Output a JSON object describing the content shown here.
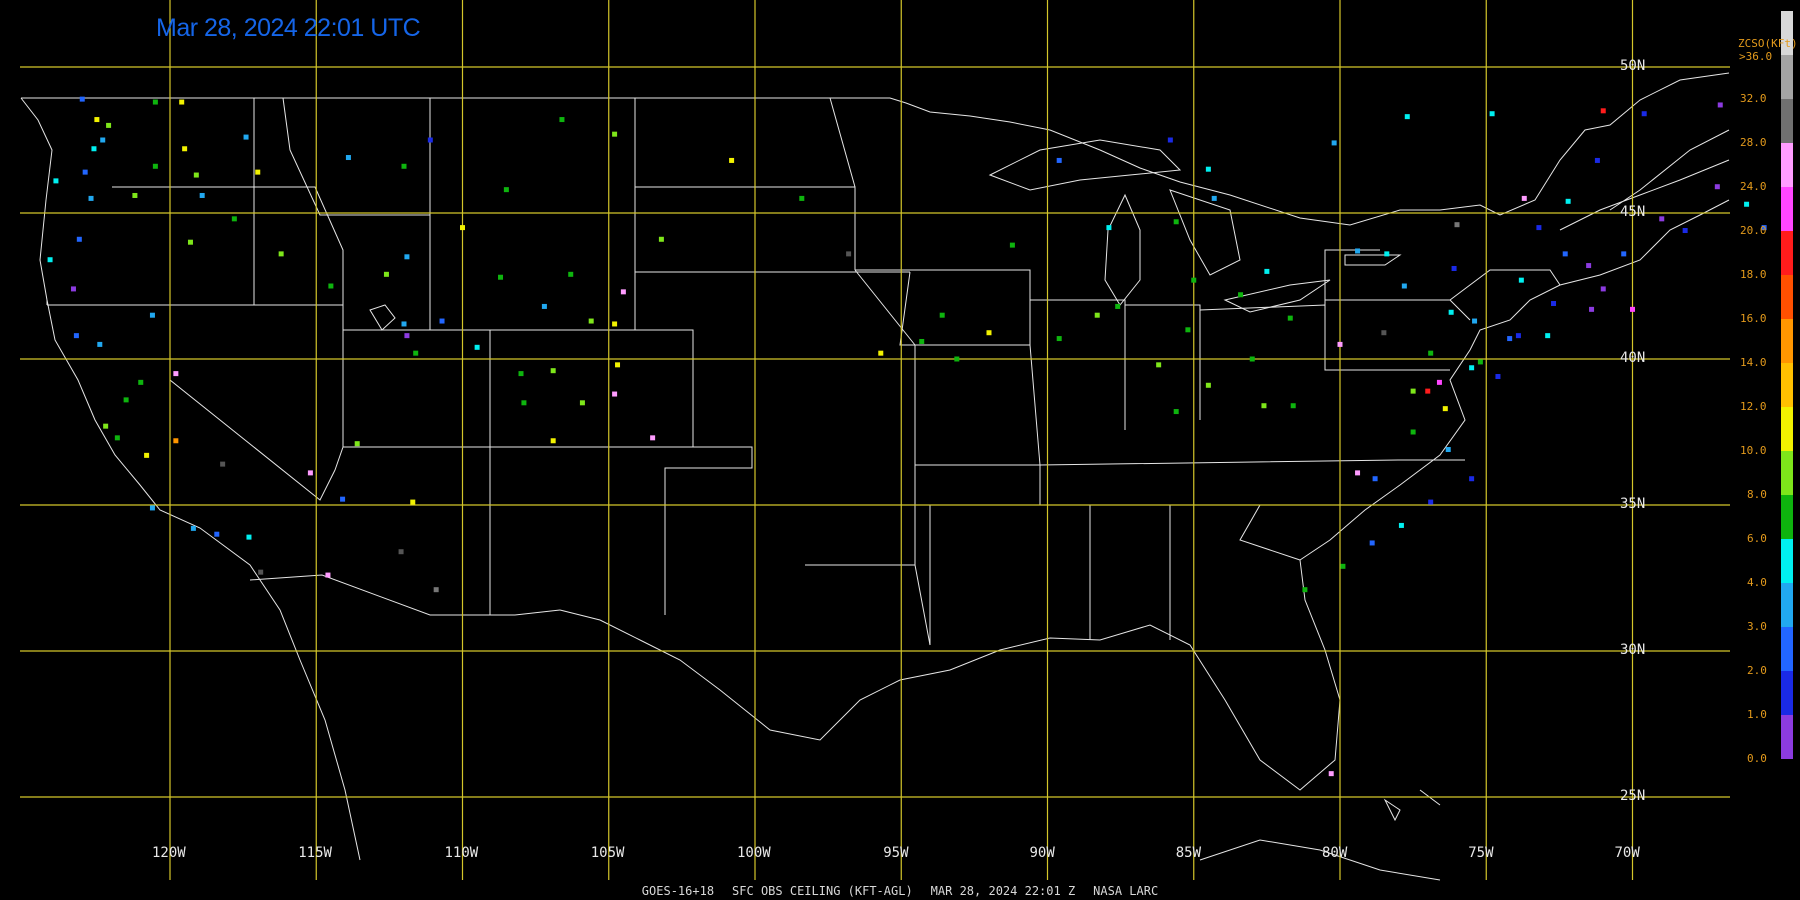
{
  "timestamp": "Mar 28, 2024 22:01 UTC",
  "footer": {
    "satellite": "GOES-16+18",
    "product": "SFC OBS CEILING (KFT-AGL)",
    "datetime": "MAR 28, 2024 22:01 Z",
    "source": "NASA LARC"
  },
  "graticule": {
    "longitudes": [
      {
        "value": -120,
        "label": "120W"
      },
      {
        "value": -115,
        "label": "115W"
      },
      {
        "value": -110,
        "label": "110W"
      },
      {
        "value": -105,
        "label": "105W"
      },
      {
        "value": -100,
        "label": "100W"
      },
      {
        "value": -95,
        "label": "95W"
      },
      {
        "value": -90,
        "label": "90W"
      },
      {
        "value": -85,
        "label": "85W"
      },
      {
        "value": -80,
        "label": "80W"
      },
      {
        "value": -75,
        "label": "75W"
      },
      {
        "value": -70,
        "label": "70W"
      }
    ],
    "latitudes": [
      {
        "value": 50,
        "label": "50N"
      },
      {
        "value": 45,
        "label": "45N"
      },
      {
        "value": 40,
        "label": "40N"
      },
      {
        "value": 35,
        "label": "35N"
      },
      {
        "value": 30,
        "label": "30N"
      },
      {
        "value": 25,
        "label": "25N"
      }
    ],
    "grid_color": "#d4c62a",
    "boundary_color": "#e6e6e6"
  },
  "legend": {
    "title": "ZCSO(KFt)",
    "top_label": ">36.0",
    "bins": [
      {
        "label": "0.0",
        "color": "#8c3be0"
      },
      {
        "label": "1.0",
        "color": "#1a2ae6"
      },
      {
        "label": "2.0",
        "color": "#2266ff"
      },
      {
        "label": "3.0",
        "color": "#21a8f0"
      },
      {
        "label": "4.0",
        "color": "#00f0f0"
      },
      {
        "label": "6.0",
        "color": "#0eb40e"
      },
      {
        "label": "8.0",
        "color": "#7ee61a"
      },
      {
        "label": "10.0",
        "color": "#f2f200"
      },
      {
        "label": "12.0",
        "color": "#ffc000"
      },
      {
        "label": "14.0",
        "color": "#ff9600"
      },
      {
        "label": "16.0",
        "color": "#ff5000"
      },
      {
        "label": "18.0",
        "color": "#ff1c1c"
      },
      {
        "label": "20.0",
        "color": "#ff46ff"
      },
      {
        "label": "24.0",
        "color": "#ff9cff"
      },
      {
        "label": "28.0",
        "color": "#707070"
      },
      {
        "label": "32.0",
        "color": "#a4a4a4"
      },
      {
        "label": "",
        "color": "#d8d8d8"
      }
    ]
  },
  "observations": [
    {
      "lon": -123.0,
      "lat": 48.9,
      "color": "#2266ff"
    },
    {
      "lon": -122.3,
      "lat": 47.5,
      "color": "#21a8f0"
    },
    {
      "lon": -122.6,
      "lat": 47.2,
      "color": "#00f0f0"
    },
    {
      "lon": -122.9,
      "lat": 46.4,
      "color": "#2266ff"
    },
    {
      "lon": -123.9,
      "lat": 46.1,
      "color": "#00f0f0"
    },
    {
      "lon": -122.7,
      "lat": 45.5,
      "color": "#21a8f0"
    },
    {
      "lon": -123.1,
      "lat": 44.1,
      "color": "#2266ff"
    },
    {
      "lon": -124.1,
      "lat": 43.4,
      "color": "#00f0f0"
    },
    {
      "lon": -123.3,
      "lat": 42.4,
      "color": "#8c3be0"
    },
    {
      "lon": -122.5,
      "lat": 48.2,
      "color": "#f2f200"
    },
    {
      "lon": -122.1,
      "lat": 48.0,
      "color": "#7ee61a"
    },
    {
      "lon": -120.5,
      "lat": 48.8,
      "color": "#0eb40e"
    },
    {
      "lon": -119.6,
      "lat": 48.8,
      "color": "#f2f200"
    },
    {
      "lon": -117.4,
      "lat": 47.6,
      "color": "#21a8f0"
    },
    {
      "lon": -119.5,
      "lat": 47.2,
      "color": "#f2f200"
    },
    {
      "lon": -119.1,
      "lat": 46.3,
      "color": "#7ee61a"
    },
    {
      "lon": -120.5,
      "lat": 46.6,
      "color": "#0eb40e"
    },
    {
      "lon": -121.2,
      "lat": 45.6,
      "color": "#7ee61a"
    },
    {
      "lon": -118.9,
      "lat": 45.6,
      "color": "#21a8f0"
    },
    {
      "lon": -117.8,
      "lat": 44.8,
      "color": "#0eb40e"
    },
    {
      "lon": -119.3,
      "lat": 44.0,
      "color": "#7ee61a"
    },
    {
      "lon": -117.0,
      "lat": 46.4,
      "color": "#f2f200"
    },
    {
      "lon": -116.2,
      "lat": 43.6,
      "color": "#7ee61a"
    },
    {
      "lon": -114.5,
      "lat": 42.5,
      "color": "#0eb40e"
    },
    {
      "lon": -112.6,
      "lat": 42.9,
      "color": "#7ee61a"
    },
    {
      "lon": -111.9,
      "lat": 43.5,
      "color": "#21a8f0"
    },
    {
      "lon": -112.0,
      "lat": 46.6,
      "color": "#0eb40e"
    },
    {
      "lon": -111.1,
      "lat": 47.5,
      "color": "#1a2ae6"
    },
    {
      "lon": -108.5,
      "lat": 45.8,
      "color": "#0eb40e"
    },
    {
      "lon": -106.6,
      "lat": 48.2,
      "color": "#0eb40e"
    },
    {
      "lon": -104.8,
      "lat": 47.7,
      "color": "#7ee61a"
    },
    {
      "lon": -113.9,
      "lat": 46.9,
      "color": "#21a8f0"
    },
    {
      "lon": -110.0,
      "lat": 44.5,
      "color": "#f2f200"
    },
    {
      "lon": -108.7,
      "lat": 42.8,
      "color": "#0eb40e"
    },
    {
      "lon": -106.3,
      "lat": 42.9,
      "color": "#0eb40e"
    },
    {
      "lon": -104.8,
      "lat": 41.2,
      "color": "#f2f200"
    },
    {
      "lon": -105.6,
      "lat": 41.3,
      "color": "#7ee61a"
    },
    {
      "lon": -107.2,
      "lat": 41.8,
      "color": "#21a8f0"
    },
    {
      "lon": -110.7,
      "lat": 41.3,
      "color": "#2266ff"
    },
    {
      "lon": -111.9,
      "lat": 40.8,
      "color": "#8c3be0"
    },
    {
      "lon": -112.0,
      "lat": 41.2,
      "color": "#21a8f0"
    },
    {
      "lon": -111.6,
      "lat": 40.2,
      "color": "#0eb40e"
    },
    {
      "lon": -109.5,
      "lat": 40.4,
      "color": "#00f0f0"
    },
    {
      "lon": -108.0,
      "lat": 39.5,
      "color": "#0eb40e"
    },
    {
      "lon": -106.9,
      "lat": 39.6,
      "color": "#7ee61a"
    },
    {
      "lon": -104.7,
      "lat": 39.8,
      "color": "#f2f200"
    },
    {
      "lon": -104.8,
      "lat": 38.8,
      "color": "#ff9cff"
    },
    {
      "lon": -105.9,
      "lat": 38.5,
      "color": "#7ee61a"
    },
    {
      "lon": -107.9,
      "lat": 38.5,
      "color": "#0eb40e"
    },
    {
      "lon": -106.9,
      "lat": 37.2,
      "color": "#f2f200"
    },
    {
      "lon": -103.5,
      "lat": 37.3,
      "color": "#ff9cff"
    },
    {
      "lon": -104.5,
      "lat": 42.3,
      "color": "#ff9cff"
    },
    {
      "lon": -103.2,
      "lat": 44.1,
      "color": "#7ee61a"
    },
    {
      "lon": -100.8,
      "lat": 46.8,
      "color": "#f2f200"
    },
    {
      "lon": -98.4,
      "lat": 45.5,
      "color": "#0eb40e"
    },
    {
      "lon": -96.8,
      "lat": 43.6,
      "color": "#555555"
    },
    {
      "lon": -113.6,
      "lat": 37.1,
      "color": "#7ee61a"
    },
    {
      "lon": -115.2,
      "lat": 36.1,
      "color": "#ff9cff"
    },
    {
      "lon": -114.1,
      "lat": 35.2,
      "color": "#2266ff"
    },
    {
      "lon": -111.7,
      "lat": 35.1,
      "color": "#f2f200"
    },
    {
      "lon": -112.1,
      "lat": 33.4,
      "color": "#555555"
    },
    {
      "lon": -110.9,
      "lat": 32.1,
      "color": "#777777"
    },
    {
      "lon": -114.6,
      "lat": 32.6,
      "color": "#ff9cff"
    },
    {
      "lon": -116.9,
      "lat": 32.7,
      "color": "#555555"
    },
    {
      "lon": -117.3,
      "lat": 33.9,
      "color": "#00f0f0"
    },
    {
      "lon": -118.4,
      "lat": 34.0,
      "color": "#2266ff"
    },
    {
      "lon": -119.2,
      "lat": 34.2,
      "color": "#21a8f0"
    },
    {
      "lon": -120.6,
      "lat": 34.9,
      "color": "#21a8f0"
    },
    {
      "lon": -120.8,
      "lat": 36.7,
      "color": "#f2f200"
    },
    {
      "lon": -121.8,
      "lat": 37.3,
      "color": "#0eb40e"
    },
    {
      "lon": -122.2,
      "lat": 37.7,
      "color": "#7ee61a"
    },
    {
      "lon": -121.5,
      "lat": 38.6,
      "color": "#0eb40e"
    },
    {
      "lon": -121.0,
      "lat": 39.2,
      "color": "#0eb40e"
    },
    {
      "lon": -119.8,
      "lat": 39.5,
      "color": "#ff9cff"
    },
    {
      "lon": -119.8,
      "lat": 37.2,
      "color": "#ff9600"
    },
    {
      "lon": -122.4,
      "lat": 40.5,
      "color": "#21a8f0"
    },
    {
      "lon": -123.2,
      "lat": 40.8,
      "color": "#2266ff"
    },
    {
      "lon": -120.6,
      "lat": 41.5,
      "color": "#21a8f0"
    },
    {
      "lon": -118.2,
      "lat": 36.4,
      "color": "#555555"
    },
    {
      "lon": -93.1,
      "lat": 40.0,
      "color": "#0eb40e"
    },
    {
      "lon": -93.6,
      "lat": 41.5,
      "color": "#0eb40e"
    },
    {
      "lon": -89.6,
      "lat": 40.7,
      "color": "#0eb40e"
    },
    {
      "lon": -88.3,
      "lat": 41.5,
      "color": "#7ee61a"
    },
    {
      "lon": -87.6,
      "lat": 41.8,
      "color": "#0eb40e"
    },
    {
      "lon": -86.2,
      "lat": 39.8,
      "color": "#7ee61a"
    },
    {
      "lon": -85.2,
      "lat": 41.0,
      "color": "#0eb40e"
    },
    {
      "lon": -84.5,
      "lat": 39.1,
      "color": "#7ee61a"
    },
    {
      "lon": -83.0,
      "lat": 40.0,
      "color": "#0eb40e"
    },
    {
      "lon": -81.7,
      "lat": 41.4,
      "color": "#0eb40e"
    },
    {
      "lon": -82.6,
      "lat": 38.4,
      "color": "#7ee61a"
    },
    {
      "lon": -81.6,
      "lat": 38.4,
      "color": "#0eb40e"
    },
    {
      "lon": -85.6,
      "lat": 38.2,
      "color": "#0eb40e"
    },
    {
      "lon": -84.3,
      "lat": 45.5,
      "color": "#21a8f0"
    },
    {
      "lon": -85.6,
      "lat": 44.7,
      "color": "#0eb40e"
    },
    {
      "lon": -87.9,
      "lat": 44.5,
      "color": "#00f0f0"
    },
    {
      "lon": -84.5,
      "lat": 46.5,
      "color": "#00f0f0"
    },
    {
      "lon": -85.0,
      "lat": 42.7,
      "color": "#0eb40e"
    },
    {
      "lon": -83.4,
      "lat": 42.2,
      "color": "#0eb40e"
    },
    {
      "lon": -82.5,
      "lat": 43.0,
      "color": "#00f0f0"
    },
    {
      "lon": -89.6,
      "lat": 46.8,
      "color": "#2266ff"
    },
    {
      "lon": -85.8,
      "lat": 47.5,
      "color": "#1a2ae6"
    },
    {
      "lon": -80.2,
      "lat": 47.4,
      "color": "#21a8f0"
    },
    {
      "lon": -77.7,
      "lat": 48.3,
      "color": "#00f0f0"
    },
    {
      "lon": -74.8,
      "lat": 48.4,
      "color": "#00f0f0"
    },
    {
      "lon": -71.0,
      "lat": 48.5,
      "color": "#ff1c1c"
    },
    {
      "lon": -69.6,
      "lat": 48.4,
      "color": "#1a2ae6"
    },
    {
      "lon": -67.0,
      "lat": 48.7,
      "color": "#8c3be0"
    },
    {
      "lon": -79.4,
      "lat": 43.7,
      "color": "#21a8f0"
    },
    {
      "lon": -76.0,
      "lat": 44.6,
      "color": "#777777"
    },
    {
      "lon": -73.7,
      "lat": 45.5,
      "color": "#ff9cff"
    },
    {
      "lon": -71.2,
      "lat": 46.8,
      "color": "#1a2ae6"
    },
    {
      "lon": -72.2,
      "lat": 45.4,
      "color": "#00f0f0"
    },
    {
      "lon": -73.2,
      "lat": 44.5,
      "color": "#1a2ae6"
    },
    {
      "lon": -72.3,
      "lat": 43.6,
      "color": "#2266ff"
    },
    {
      "lon": -71.5,
      "lat": 43.2,
      "color": "#8c3be0"
    },
    {
      "lon": -70.3,
      "lat": 43.6,
      "color": "#2266ff"
    },
    {
      "lon": -69.0,
      "lat": 44.8,
      "color": "#8c3be0"
    },
    {
      "lon": -68.2,
      "lat": 44.4,
      "color": "#1a2ae6"
    },
    {
      "lon": -67.1,
      "lat": 45.9,
      "color": "#8c3be0"
    },
    {
      "lon": -65.5,
      "lat": 44.5,
      "color": "#2266ff"
    },
    {
      "lon": -66.1,
      "lat": 45.3,
      "color": "#00f0f0"
    },
    {
      "lon": -73.8,
      "lat": 42.7,
      "color": "#00f0f0"
    },
    {
      "lon": -72.7,
      "lat": 41.9,
      "color": "#1a2ae6"
    },
    {
      "lon": -71.4,
      "lat": 41.7,
      "color": "#8c3be0"
    },
    {
      "lon": -71.0,
      "lat": 42.4,
      "color": "#8c3be0"
    },
    {
      "lon": -70.0,
      "lat": 41.7,
      "color": "#ff46ff"
    },
    {
      "lon": -73.9,
      "lat": 40.8,
      "color": "#1a2ae6"
    },
    {
      "lon": -74.2,
      "lat": 40.7,
      "color": "#2266ff"
    },
    {
      "lon": -72.9,
      "lat": 40.8,
      "color": "#00f0f0"
    },
    {
      "lon": -75.2,
      "lat": 39.9,
      "color": "#0eb40e"
    },
    {
      "lon": -74.6,
      "lat": 39.4,
      "color": "#1a2ae6"
    },
    {
      "lon": -75.5,
      "lat": 39.7,
      "color": "#00f0f0"
    },
    {
      "lon": -76.6,
      "lat": 39.2,
      "color": "#ff46ff"
    },
    {
      "lon": -77.0,
      "lat": 38.9,
      "color": "#ff1c1c"
    },
    {
      "lon": -77.5,
      "lat": 38.9,
      "color": "#7ee61a"
    },
    {
      "lon": -76.4,
      "lat": 38.3,
      "color": "#f2f200"
    },
    {
      "lon": -77.5,
      "lat": 37.5,
      "color": "#0eb40e"
    },
    {
      "lon": -76.3,
      "lat": 36.9,
      "color": "#21a8f0"
    },
    {
      "lon": -75.5,
      "lat": 35.9,
      "color": "#1a2ae6"
    },
    {
      "lon": -76.9,
      "lat": 35.1,
      "color": "#1a2ae6"
    },
    {
      "lon": -77.9,
      "lat": 34.3,
      "color": "#00f0f0"
    },
    {
      "lon": -78.9,
      "lat": 33.7,
      "color": "#2266ff"
    },
    {
      "lon": -79.9,
      "lat": 32.9,
      "color": "#0eb40e"
    },
    {
      "lon": -81.2,
      "lat": 32.1,
      "color": "#0eb40e"
    },
    {
      "lon": -78.8,
      "lat": 35.9,
      "color": "#2266ff"
    },
    {
      "lon": -79.4,
      "lat": 36.1,
      "color": "#ff9cff"
    },
    {
      "lon": -80.0,
      "lat": 40.5,
      "color": "#ff9cff"
    },
    {
      "lon": -77.8,
      "lat": 42.5,
      "color": "#21a8f0"
    },
    {
      "lon": -76.1,
      "lat": 43.1,
      "color": "#1a2ae6"
    },
    {
      "lon": -78.4,
      "lat": 43.6,
      "color": "#00f0f0"
    },
    {
      "lon": -75.4,
      "lat": 41.3,
      "color": "#21a8f0"
    },
    {
      "lon": -76.9,
      "lat": 40.2,
      "color": "#0eb40e"
    },
    {
      "lon": -76.2,
      "lat": 41.6,
      "color": "#00f0f0"
    },
    {
      "lon": -78.5,
      "lat": 40.9,
      "color": "#555555"
    },
    {
      "lon": -80.3,
      "lat": 25.8,
      "color": "#ff9cff"
    },
    {
      "lon": -91.2,
      "lat": 43.9,
      "color": "#0eb40e"
    },
    {
      "lon": -95.7,
      "lat": 40.2,
      "color": "#f2f200"
    },
    {
      "lon": -94.3,
      "lat": 40.6,
      "color": "#0eb40e"
    },
    {
      "lon": -92.0,
      "lat": 40.9,
      "color": "#f2f200"
    }
  ]
}
